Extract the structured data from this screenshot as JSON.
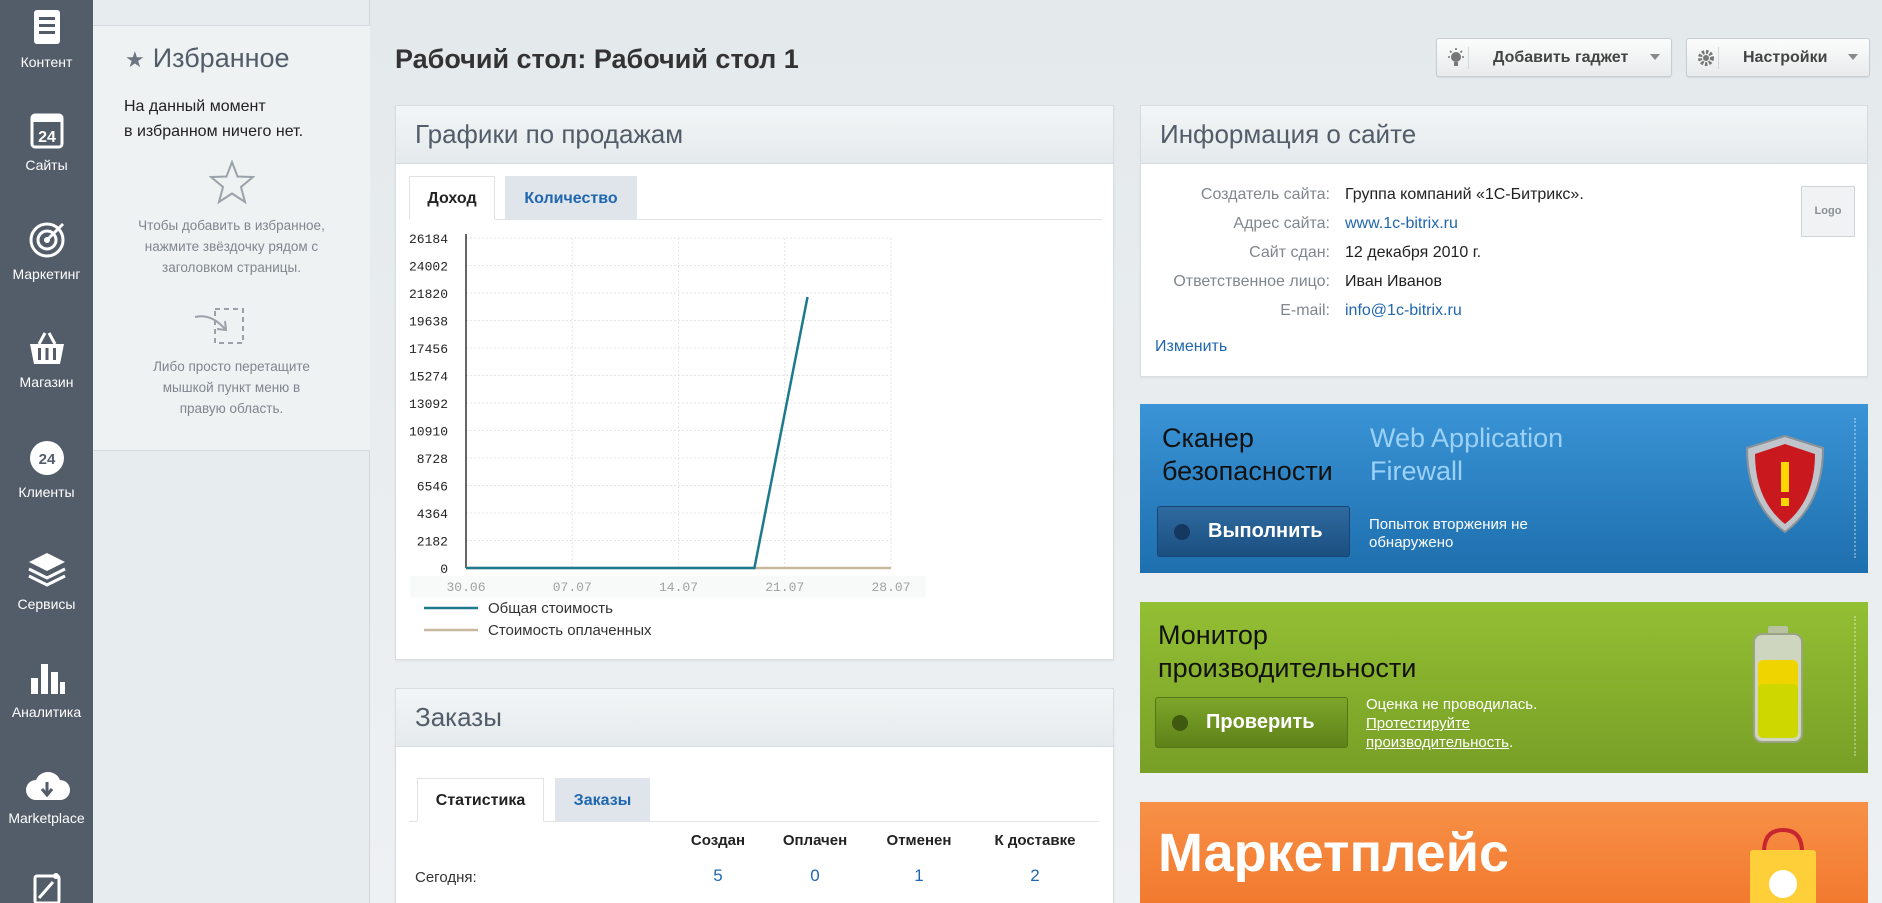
{
  "nav": [
    {
      "label": "Контент",
      "icon": "content-icon"
    },
    {
      "label": "Сайты",
      "icon": "sites-icon"
    },
    {
      "label": "Маркетинг",
      "icon": "target-icon"
    },
    {
      "label": "Магазин",
      "icon": "basket-icon"
    },
    {
      "label": "Клиенты",
      "icon": "clients-icon"
    },
    {
      "label": "Сервисы",
      "icon": "services-icon"
    },
    {
      "label": "Аналитика",
      "icon": "analytics-icon"
    },
    {
      "label": "Marketplace",
      "icon": "marketplace-icon"
    }
  ],
  "favorites": {
    "title": "Избранное",
    "empty_line1": "На данный момент",
    "empty_line2": "в избранном ничего нет.",
    "hint1_l1": "Чтобы добавить в избранное,",
    "hint1_l2": "нажмите звёздочку рядом с",
    "hint1_l3": "заголовком страницы.",
    "hint2_l1": "Либо просто перетащите",
    "hint2_l2": "мышкой пункт меню в",
    "hint2_l3": "правую область."
  },
  "page_title": "Рабочий стол: Рабочий стол 1",
  "toolbar": {
    "add_gadget": "Добавить гаджет",
    "settings": "Настройки"
  },
  "sales": {
    "title": "Графики по продажам",
    "tab_income": "Доход",
    "tab_quantity": "Количество"
  },
  "chart_data": {
    "type": "line",
    "x": [
      "30.06",
      "07.07",
      "14.07",
      "21.07",
      "28.07"
    ],
    "y_ticks": [
      26184,
      24002,
      21820,
      19638,
      17456,
      15274,
      13092,
      10910,
      8728,
      6546,
      4364,
      2182,
      0
    ],
    "ylim": [
      0,
      26184
    ],
    "x_range_days": [
      0,
      28
    ],
    "series": [
      {
        "name": "Общая стоимость",
        "color": "#1c7a8c",
        "points": [
          [
            0,
            0
          ],
          [
            19,
            0
          ],
          [
            22.5,
            21500
          ]
        ]
      },
      {
        "name": "Стоимость оплаченных",
        "color": "#c9b8a0",
        "points": [
          [
            0,
            0
          ],
          [
            28,
            0
          ]
        ]
      }
    ],
    "grid": true,
    "legend": "bottom-left"
  },
  "orders": {
    "title": "Заказы",
    "tab_stats": "Статистика",
    "tab_orders": "Заказы",
    "columns": [
      "Создан",
      "Оплачен",
      "Отменен",
      "К доставке"
    ],
    "row_label": "Сегодня:",
    "row_values": [
      "5",
      "0",
      "1",
      "2"
    ]
  },
  "site_info": {
    "title": "Информация о сайте",
    "creator_label": "Создатель сайта:",
    "creator": "Группа компаний «1С-Битрикс».",
    "address_label": "Адрес сайта:",
    "address": "www.1c-bitrix.ru",
    "date_label": "Сайт сдан:",
    "date": "12 декабря 2010 г.",
    "person_label": "Ответственное лицо:",
    "person": "Иван Иванов",
    "email_label": "E-mail:",
    "email": "info@1c-bitrix.ru",
    "edit": "Изменить",
    "logo": "Logo"
  },
  "scanner": {
    "title_l1": "Сканер",
    "title_l2": "безопасности",
    "waf_l1": "Web Application",
    "waf_l2": "Firewall",
    "button": "Выполнить",
    "status_l1": "Попыток вторжения не",
    "status_l2": "обнаружено",
    "color": "#2d84c6"
  },
  "monitor": {
    "title_l1": "Монитор",
    "title_l2": "производительности",
    "button": "Проверить",
    "status_l1": "Оценка не проводилась.",
    "link_l1": "Протестируйте",
    "link_l2": "производительность",
    "link_suffix": ".",
    "color": "#8ab42c"
  },
  "marketplace": {
    "title": "Маркетплейс",
    "color": "#f27a2f"
  }
}
